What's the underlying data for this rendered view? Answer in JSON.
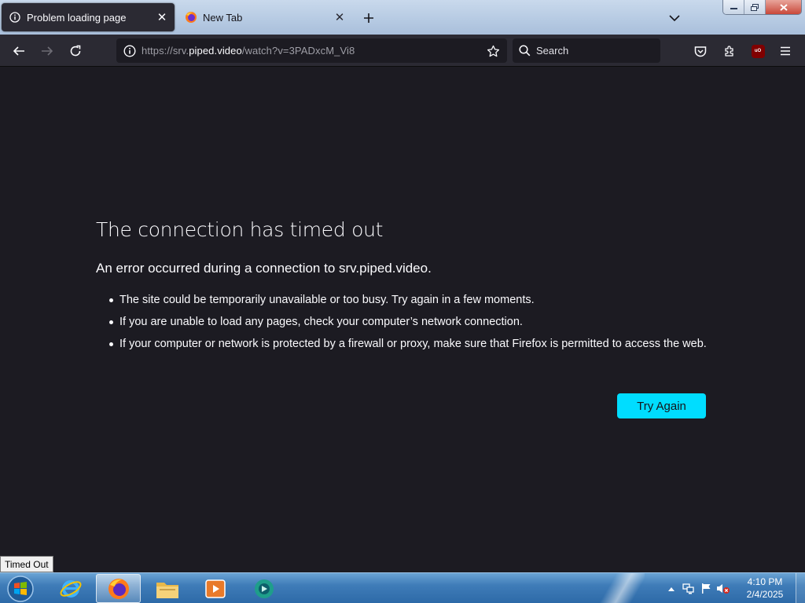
{
  "tabs": [
    {
      "title": "Problem loading page",
      "active": true,
      "icon": "info-icon"
    },
    {
      "title": "New Tab",
      "active": false,
      "icon": "firefox-icon"
    }
  ],
  "navbar": {
    "url_prefix": "https://srv.",
    "url_domain": "piped.video",
    "url_suffix": "/watch?v=3PADxcM_Vi8",
    "search_placeholder": "Search"
  },
  "error": {
    "title": "The connection has timed out",
    "subtitle": "An error occurred during a connection to srv.piped.video.",
    "items": [
      "The site could be temporarily unavailable or too busy. Try again in a few moments.",
      "If you are unable to load any pages, check your computer’s network connection.",
      "If your computer or network is protected by a firewall or proxy, make sure that Firefox is permitted to access the web."
    ],
    "button": "Try Again"
  },
  "status_tooltip": "Timed Out",
  "taskbar": {
    "items": [
      "internet-explorer-icon",
      "firefox-icon",
      "file-explorer-icon",
      "media-player-icon",
      "app-icon"
    ],
    "time": "4:10 PM",
    "date": "2/4/2025"
  },
  "colors": {
    "accent_button": "#00ddff",
    "page_bg": "#1c1b22",
    "toolbar_bg": "#2b2a33"
  }
}
